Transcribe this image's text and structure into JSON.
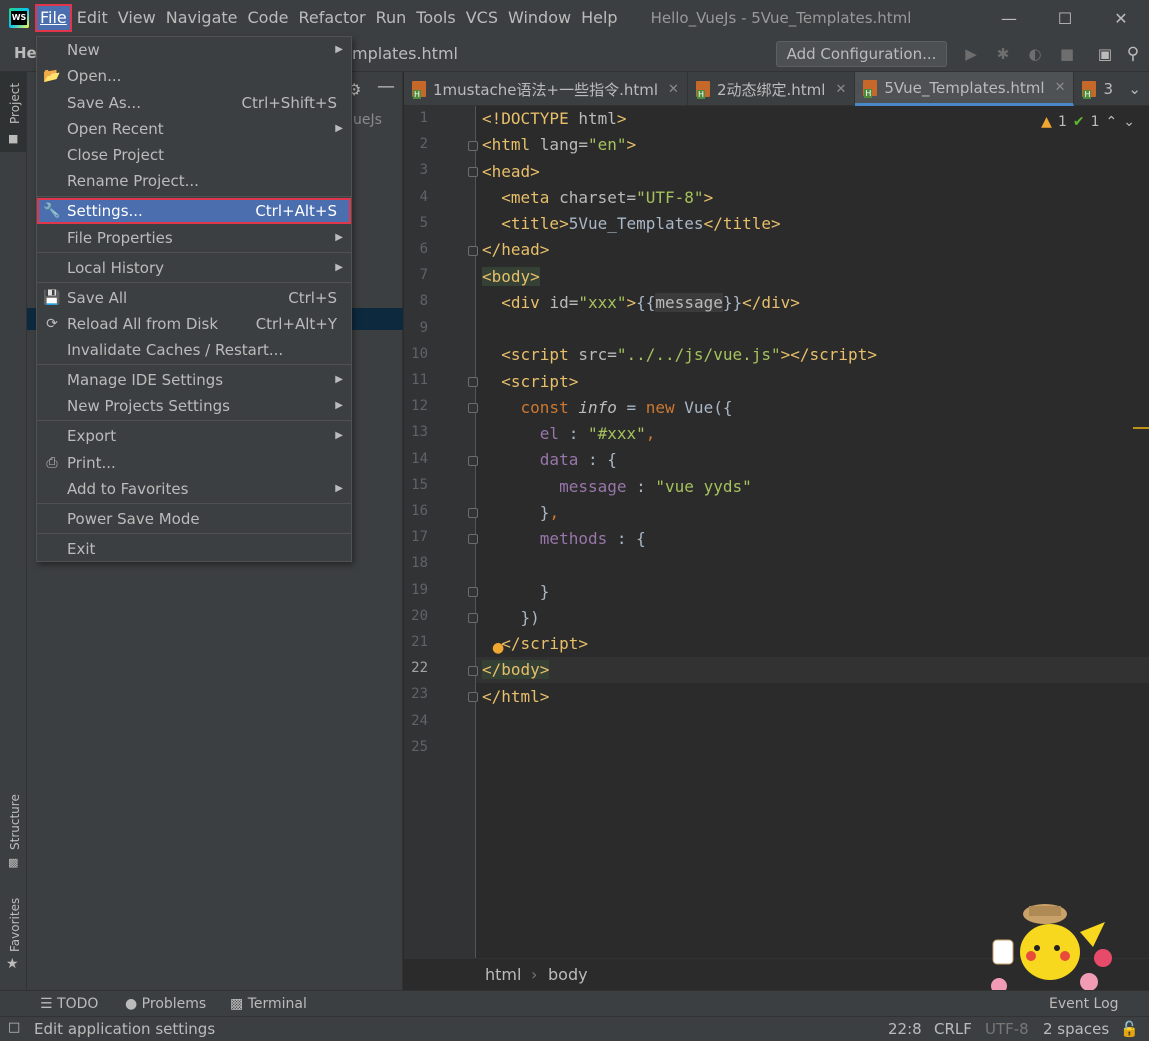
{
  "menubar": {
    "items": [
      "File",
      "Edit",
      "View",
      "Navigate",
      "Code",
      "Refactor",
      "Run",
      "Tools",
      "VCS",
      "Window",
      "Help"
    ],
    "window_title": "Hello_VueJs - 5Vue_Templates.html"
  },
  "navbar": {
    "project": "He",
    "file": "mplates.html",
    "add_configuration": "Add Configuration..."
  },
  "left_stripe": {
    "project": "Project",
    "structure": "Structure",
    "favorites": "Favorites"
  },
  "project_panel": {
    "tree_hint": "ueJs"
  },
  "tabs": [
    {
      "label": "1mustache语法+一些指令.html",
      "active": false
    },
    {
      "label": "2动态绑定.html",
      "active": false
    },
    {
      "label": "5Vue_Templates.html",
      "active": true
    },
    {
      "label": "3",
      "active": false
    }
  ],
  "inspections": {
    "warnings": "1",
    "ok": "1"
  },
  "editor": {
    "line_numbers": [
      "1",
      "2",
      "3",
      "4",
      "5",
      "6",
      "7",
      "8",
      "9",
      "10",
      "11",
      "12",
      "13",
      "14",
      "15",
      "16",
      "17",
      "18",
      "19",
      "20",
      "21",
      "22",
      "23",
      "24",
      "25"
    ],
    "current_line": "22"
  },
  "breadcrumbs": {
    "first": "html",
    "second": "body"
  },
  "tool_windows": {
    "todo": "TODO",
    "problems": "Problems",
    "terminal": "Terminal",
    "event_log": "Event Log"
  },
  "status": {
    "message": "Edit application settings",
    "position": "22:8",
    "line_sep": "CRLF",
    "encoding": "UTF-8",
    "indent": "2 spaces"
  },
  "file_menu": {
    "new": "New",
    "open": "Open...",
    "save_as": "Save As...",
    "save_as_sc": "Ctrl+Shift+S",
    "open_recent": "Open Recent",
    "close_project": "Close Project",
    "rename_project": "Rename Project...",
    "settings": "Settings...",
    "settings_sc": "Ctrl+Alt+S",
    "file_properties": "File Properties",
    "local_history": "Local History",
    "save_all": "Save All",
    "save_all_sc": "Ctrl+S",
    "reload_all": "Reload All from Disk",
    "reload_all_sc": "Ctrl+Alt+Y",
    "invalidate": "Invalidate Caches / Restart...",
    "manage_ide": "Manage IDE Settings",
    "new_projects": "New Projects Settings",
    "export": "Export",
    "print": "Print...",
    "add_favorites": "Add to Favorites",
    "power_save": "Power Save Mode",
    "exit": "Exit"
  }
}
